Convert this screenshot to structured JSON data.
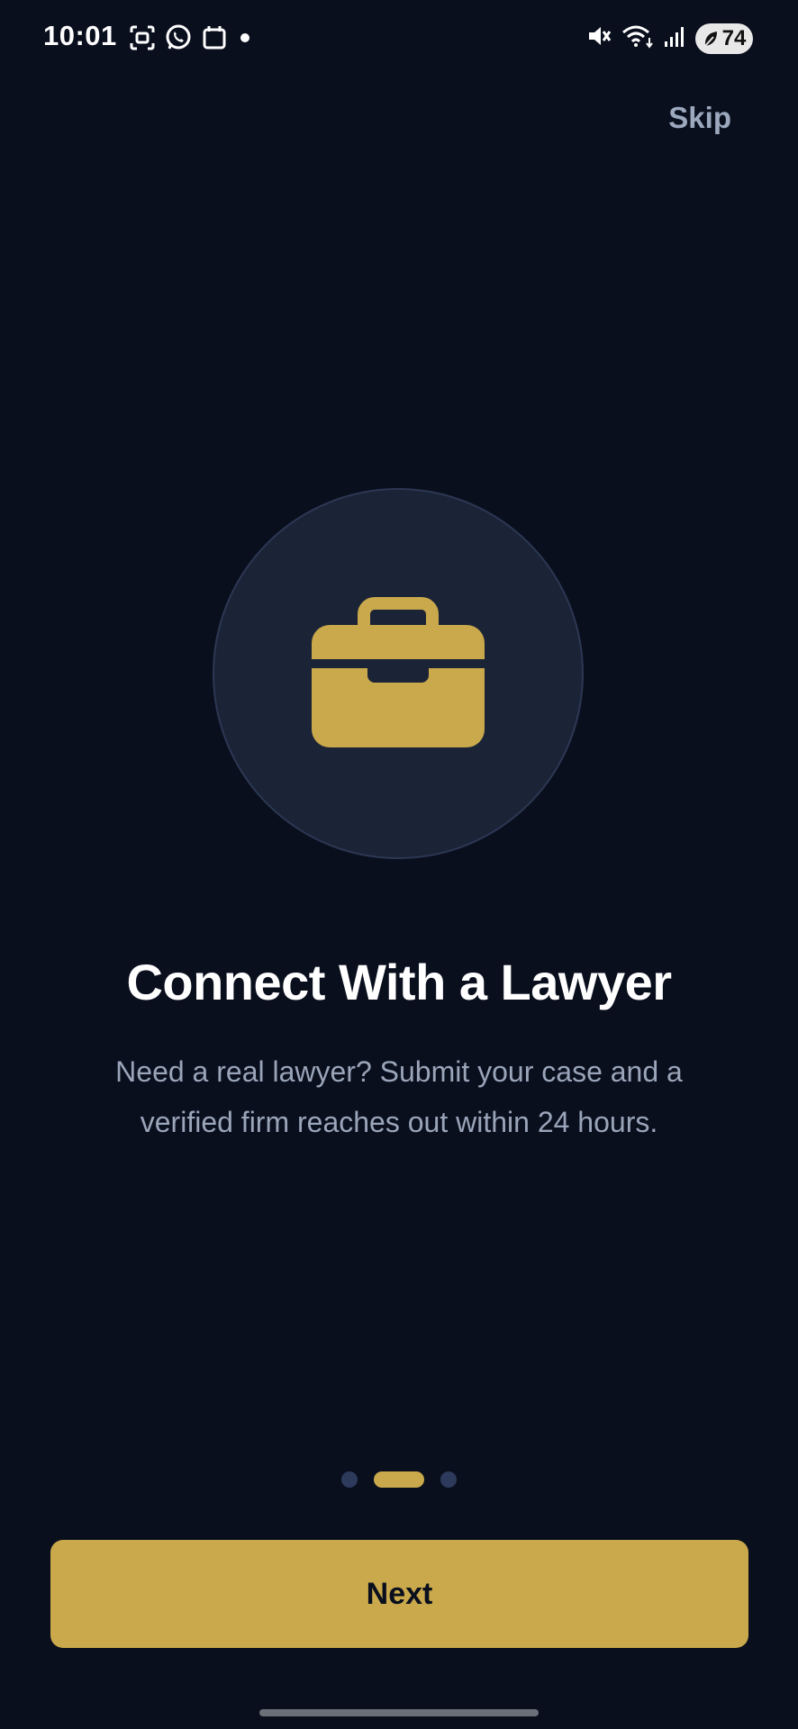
{
  "status_bar": {
    "time": "10:01",
    "battery_level": "74",
    "left_icons": [
      "screenshot-icon",
      "whatsapp-icon",
      "calendar-icon",
      "dot-icon"
    ],
    "right_icons": [
      "mute-icon",
      "wifi-icon",
      "signal-icon",
      "battery-icon"
    ]
  },
  "header": {
    "skip_label": "Skip"
  },
  "hero": {
    "icon": "briefcase-icon",
    "icon_color": "#c9a94b",
    "circle_color": "#1b2337"
  },
  "content": {
    "title": "Connect With a Lawyer",
    "description": "Need a real lawyer? Submit your case and a verified firm reaches out within 24 hours."
  },
  "pager": {
    "total": 3,
    "active_index": 1
  },
  "footer": {
    "next_label": "Next"
  },
  "colors": {
    "background": "#0a0f1e",
    "accent": "#c9a94b",
    "muted_text": "#9aa5b9"
  }
}
